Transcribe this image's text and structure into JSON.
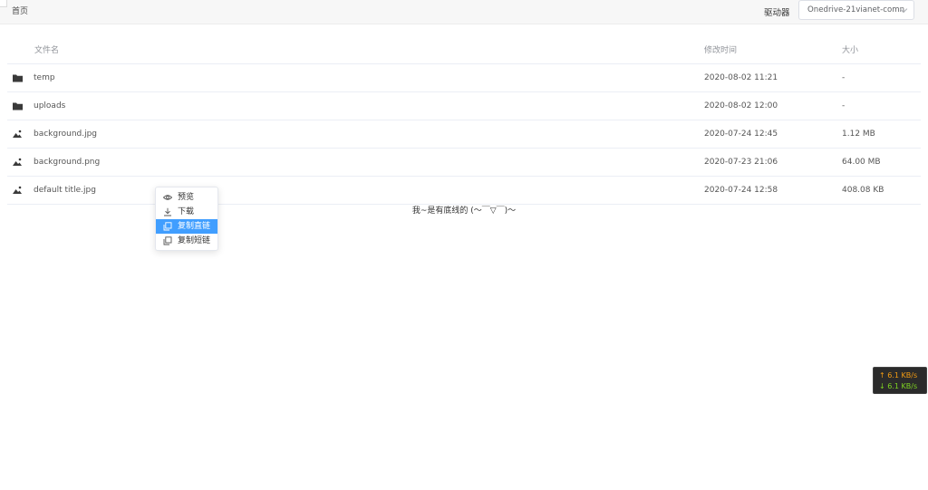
{
  "header": {
    "breadcrumb": "首页",
    "drive_label": "驱动器",
    "drive_value": "Onedrive-21vianet-comn"
  },
  "table": {
    "columns": {
      "name": "文件名",
      "modified": "修改时间",
      "size": "大小"
    },
    "rows": [
      {
        "icon": "folder-icon",
        "name": "temp",
        "modified": "2020-08-02 11:21",
        "size": "-"
      },
      {
        "icon": "folder-icon",
        "name": "uploads",
        "modified": "2020-08-02 12:00",
        "size": "-"
      },
      {
        "icon": "image-icon",
        "name": "background.jpg",
        "modified": "2020-07-24 12:45",
        "size": "1.12 MB"
      },
      {
        "icon": "image-icon",
        "name": "background.png",
        "modified": "2020-07-23 21:06",
        "size": "64.00 MB"
      },
      {
        "icon": "image-icon",
        "name": "default title.jpg",
        "modified": "2020-07-24 12:58",
        "size": "408.08 KB"
      }
    ]
  },
  "footer": {
    "text": "我~是有底线的 (～￣▽￣)～"
  },
  "context_menu": {
    "items": [
      {
        "label": "预览",
        "icon": "eye-icon"
      },
      {
        "label": "下载",
        "icon": "download-icon"
      },
      {
        "label": "复制直链",
        "icon": "copy-icon",
        "active": true
      },
      {
        "label": "复制短链",
        "icon": "copy-icon"
      }
    ]
  },
  "speed_widget": {
    "upload": "↑ 6.1 KB/s",
    "download": "↓ 6.1 KB/s"
  },
  "colors": {
    "accent": "#409eff",
    "upload": "#f39c12",
    "download": "#7ed321"
  }
}
